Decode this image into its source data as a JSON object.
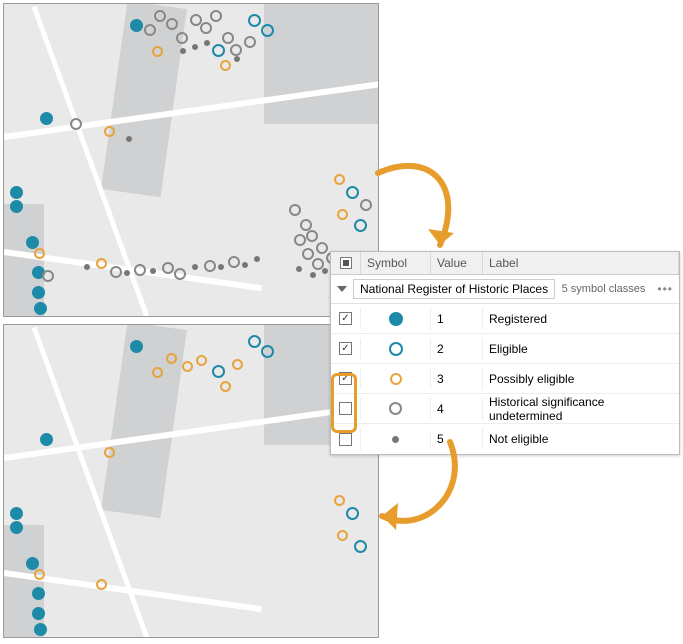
{
  "legend": {
    "header": {
      "symbol": "Symbol",
      "value": "Value",
      "label": "Label"
    },
    "layer_name": "National Register of Historic Places",
    "classes_note": "5 symbol classes",
    "rows": [
      {
        "checked": true,
        "value": "1",
        "label": "Registered"
      },
      {
        "checked": true,
        "value": "2",
        "label": "Eligible"
      },
      {
        "checked": true,
        "value": "3",
        "label": "Possibly eligible"
      },
      {
        "checked": false,
        "value": "4",
        "label": "Historical significance undetermined"
      },
      {
        "checked": false,
        "value": "5",
        "label": "Not eligible"
      }
    ]
  }
}
